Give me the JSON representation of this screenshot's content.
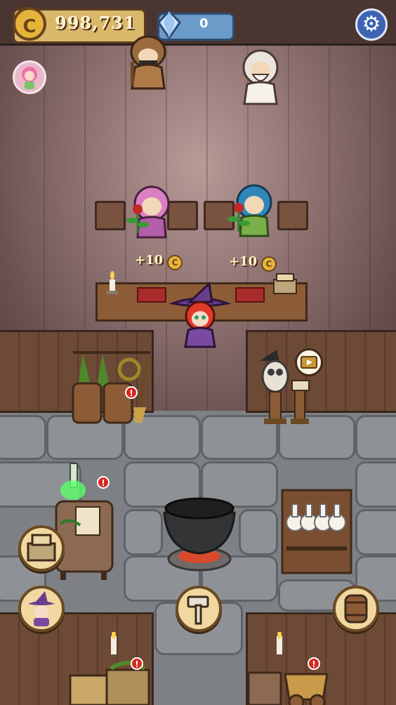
{
  "hud": {
    "coins": "998,731",
    "coin_symbol": "C",
    "gems": "0",
    "settings_icon": "gear-icon",
    "avatar_icon": "pink-haired-girl-avatar"
  },
  "customers": [
    {
      "name": "brown-hooded-bandit",
      "color": "#9a6b3f"
    },
    {
      "name": "old-bearded-man",
      "color": "#f1ebe1"
    },
    {
      "name": "pink-haired-customer",
      "color": "#d980c2"
    },
    {
      "name": "teal-haired-customer",
      "color": "#2f86b7"
    }
  ],
  "income_popups": [
    {
      "text": "+10",
      "currency": "C"
    },
    {
      "text": "+10",
      "currency": "C"
    }
  ],
  "alerts": {
    "mark": "!"
  },
  "actions": {
    "cash_register_icon": "cash-register-icon",
    "witch_icon": "witch-icon",
    "hammer_icon": "hammer-icon",
    "barrel_icon": "barrel-icon",
    "video_icon": "video-ad-icon"
  },
  "colors": {
    "coin_gold": "#e7b43a",
    "gem_blue": "#6b9bc9",
    "alert_red": "#d7261e",
    "witch_purple": "#6a3c8c",
    "potion_green": "#5bff6a"
  }
}
